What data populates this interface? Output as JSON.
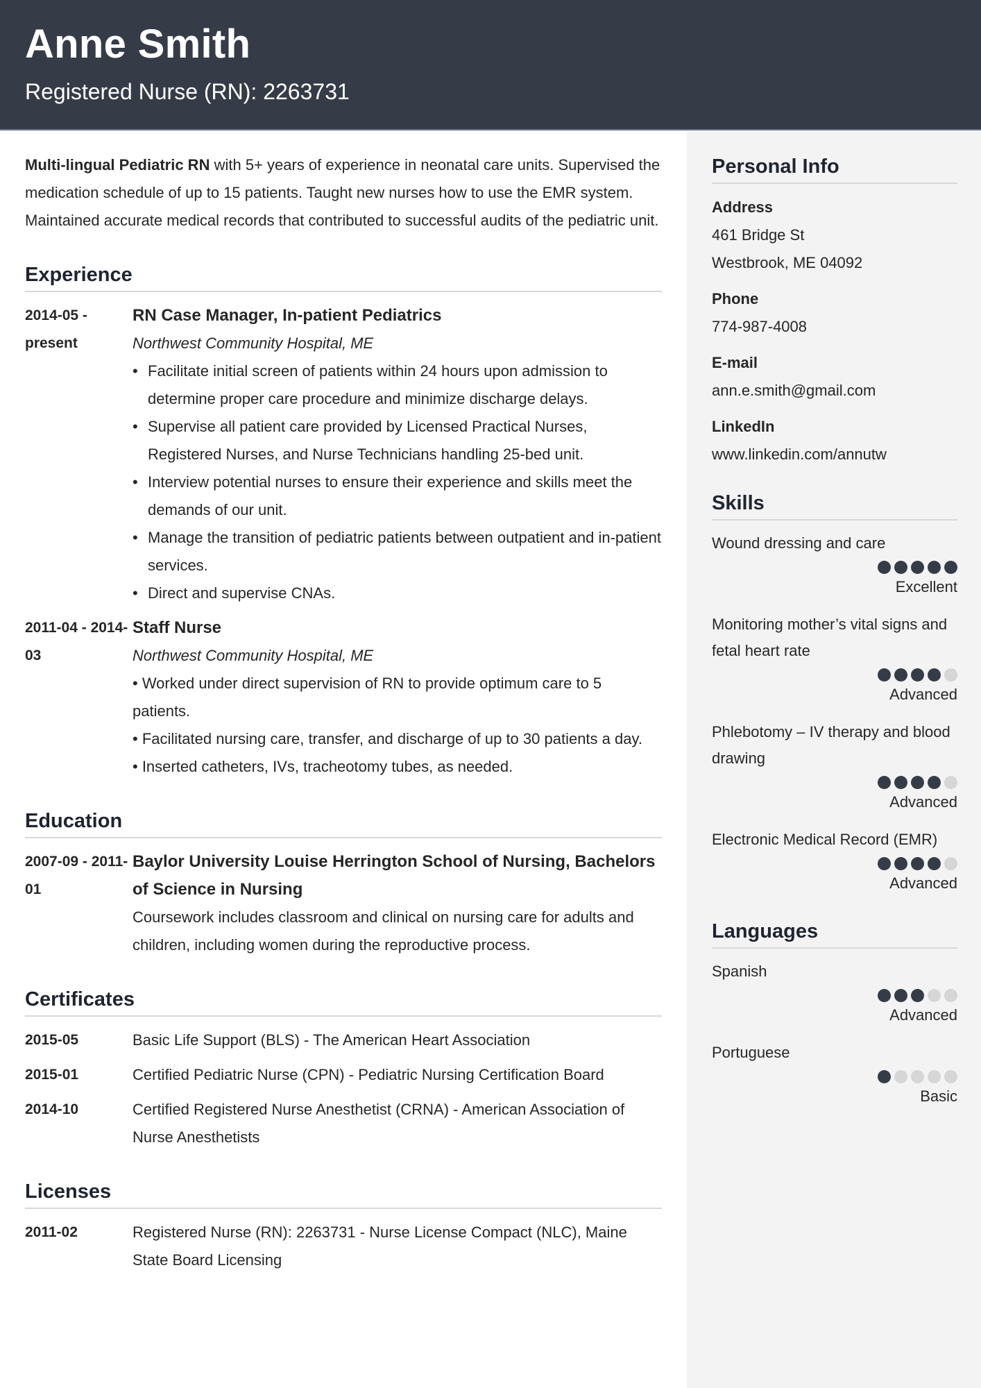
{
  "header": {
    "name": "Anne Smith",
    "title": "Registered Nurse (RN): 2263731"
  },
  "summary": {
    "bold": "Multi-lingual Pediatric RN",
    "text": " with 5+ years of experience in neonatal care units. Supervised the medication schedule of up to 15 patients. Taught new nurses how to use the EMR system. Maintained accurate medical records that contributed to successful audits of the pediatric unit."
  },
  "experience": {
    "title": "Experience",
    "items": [
      {
        "date": "2014-05 - present",
        "role": "RN Case Manager, In-patient Pediatrics",
        "org": "Northwest Community Hospital, ME",
        "bullets": [
          "Facilitate initial screen of patients within 24 hours upon admission to determine proper care procedure and minimize discharge delays.",
          "Supervise all patient care provided by Licensed Practical Nurses, Registered Nurses, and Nurse Technicians handling 25-bed unit.",
          "Interview potential nurses to ensure their experience and skills meet the demands of our unit.",
          "Manage the transition of pediatric patients between outpatient and in-patient services.",
          "Direct and supervise CNAs."
        ]
      },
      {
        "date": "2011-04 - 2014-03",
        "role": "Staff Nurse",
        "org": "Northwest Community Hospital, ME",
        "lines": [
          "• Worked under direct supervision of RN to provide optimum care to 5 patients.",
          "• Facilitated nursing care, transfer, and discharge of up to 30 patients a day.",
          "• Inserted catheters, IVs, tracheotomy tubes, as needed."
        ]
      }
    ]
  },
  "education": {
    "title": "Education",
    "items": [
      {
        "date": "2007-09 - 2011-01",
        "school": "Baylor University Louise Herrington School of Nursing, Bachelors of Science in Nursing",
        "description": "Coursework includes classroom and clinical on nursing care for adults and children, including women during the reproductive process."
      }
    ]
  },
  "certificates": {
    "title": "Certificates",
    "items": [
      {
        "date": "2015-05",
        "text": "Basic Life Support (BLS) - The American Heart Association"
      },
      {
        "date": "2015-01",
        "text": "Certified Pediatric Nurse (CPN) - Pediatric Nursing Certification Board"
      },
      {
        "date": "2014-10",
        "text": "Certified Registered Nurse Anesthetist (CRNA) - American Association of Nurse Anesthetists"
      }
    ]
  },
  "licenses": {
    "title": "Licenses",
    "items": [
      {
        "date": "2011-02",
        "text": "Registered Nurse (RN): 2263731 - Nurse License Compact (NLC), Maine State Board Licensing"
      }
    ]
  },
  "personal_info": {
    "title": "Personal Info",
    "address_label": "Address",
    "address_line1": "461 Bridge St",
    "address_line2": "Westbrook, ME 04092",
    "phone_label": "Phone",
    "phone": "774-987-4008",
    "email_label": "E-mail",
    "email": "ann.e.smith@gmail.com",
    "linkedin_label": "LinkedIn",
    "linkedin": "www.linkedin.com/annutw"
  },
  "skills": {
    "title": "Skills",
    "max_rating": 5,
    "items": [
      {
        "name": "Wound dressing and care",
        "rating": 5,
        "level": "Excellent"
      },
      {
        "name": "Monitoring mother’s vital signs and fetal heart rate",
        "rating": 4,
        "level": "Advanced"
      },
      {
        "name": "Phlebotomy – IV therapy and blood drawing",
        "rating": 4,
        "level": "Advanced"
      },
      {
        "name": "Electronic Medical Record (EMR)",
        "rating": 4,
        "level": "Advanced"
      }
    ]
  },
  "languages": {
    "title": "Languages",
    "max_rating": 5,
    "items": [
      {
        "name": "Spanish",
        "rating": 3,
        "level": "Advanced"
      },
      {
        "name": "Portuguese",
        "rating": 1,
        "level": "Basic"
      }
    ]
  },
  "colors": {
    "header_bg": "#363c47",
    "sidebar_bg": "#f3f3f3",
    "dot_filled": "#363c47",
    "dot_empty": "#d6d6d6"
  }
}
